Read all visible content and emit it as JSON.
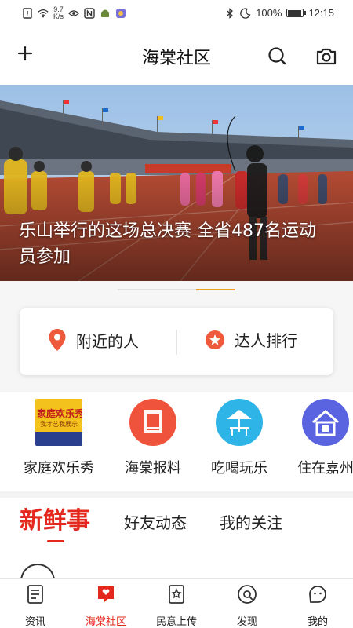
{
  "status_bar": {
    "net_speed_value": "9.7",
    "net_speed_unit": "K/s",
    "battery": "100%",
    "battery_level": 1.0,
    "time": "12:15"
  },
  "header": {
    "title": "海棠社区",
    "icons": [
      "plus-icon",
      "search-icon",
      "camera-icon"
    ]
  },
  "banner": {
    "caption": "乐山举行的这场总决赛 全省487名运动员参加",
    "active_slide": 2,
    "slide_count": 2
  },
  "quick_card": {
    "items": [
      {
        "label": "附近的人",
        "icon": "location-pin-icon"
      },
      {
        "label": "达人排行",
        "icon": "star-badge-icon"
      }
    ]
  },
  "features": [
    {
      "label": "家庭欢乐秀",
      "icon": "family-show-poster-icon",
      "poster_title": "家庭欢乐秀",
      "poster_subtitle": "我才艺我展示"
    },
    {
      "label": "海棠报料",
      "icon": "report-icon"
    },
    {
      "label": "吃喝玩乐",
      "icon": "umbrella-table-icon"
    },
    {
      "label": "住在嘉州",
      "icon": "house-icon"
    }
  ],
  "content_tabs": {
    "items": [
      "新鲜事",
      "好友动态",
      "我的关注"
    ],
    "active_index": 0
  },
  "bottom_nav": {
    "items": [
      {
        "label": "资讯",
        "icon": "news-icon"
      },
      {
        "label": "海棠社区",
        "icon": "community-icon"
      },
      {
        "label": "民意上传",
        "icon": "upload-opinion-icon"
      },
      {
        "label": "发现",
        "icon": "discover-icon"
      },
      {
        "label": "我的",
        "icon": "profile-icon"
      }
    ],
    "active_index": 1
  },
  "colors": {
    "accent": "#e5281d",
    "banner_indicator_active": "#f0a020"
  }
}
